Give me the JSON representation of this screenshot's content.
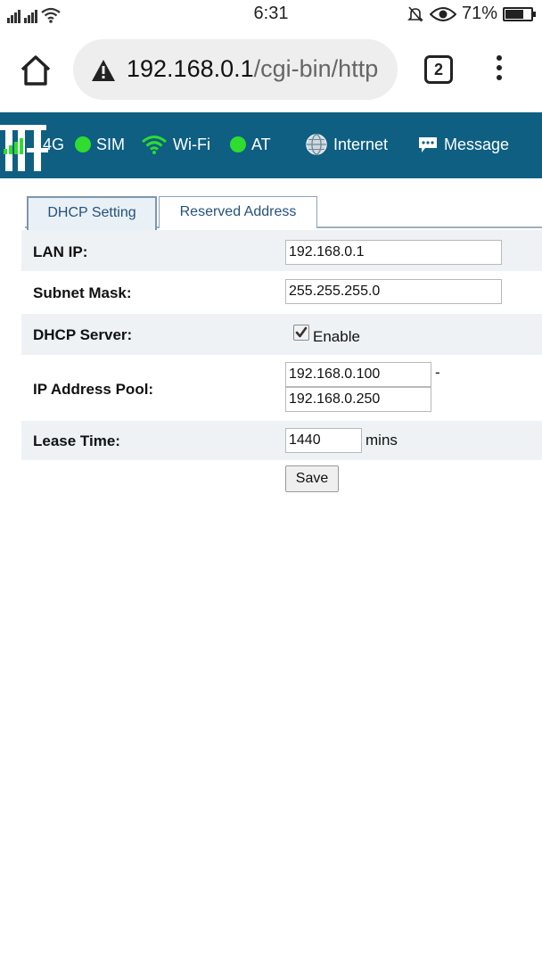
{
  "status_bar": {
    "time": "6:31",
    "battery_percent": "71%",
    "battery_level": 0.71
  },
  "browser": {
    "url_host": "192.168.0.1",
    "url_path": "/cgi-bin/http",
    "tab_count": "2"
  },
  "router_nav": {
    "items": [
      {
        "label": "4G",
        "icon": "signal-bars-icon"
      },
      {
        "label": "SIM",
        "icon": "green-dot-icon"
      },
      {
        "label": "Wi-Fi",
        "icon": "wifi-icon"
      },
      {
        "label": "AT",
        "icon": "green-dot-icon"
      },
      {
        "label": "Internet",
        "icon": "globe-icon"
      },
      {
        "label": "Message",
        "icon": "chat-bubble-icon"
      }
    ]
  },
  "tabs": [
    {
      "label": "DHCP Setting",
      "active": true
    },
    {
      "label": "Reserved Address",
      "active": false
    }
  ],
  "form": {
    "lan_ip": {
      "label": "LAN IP:",
      "value": "192.168.0.1"
    },
    "subnet_mask": {
      "label": "Subnet Mask:",
      "value": "255.255.255.0"
    },
    "dhcp_server": {
      "label": "DHCP Server:",
      "checkbox_label": "Enable",
      "checked": true
    },
    "ip_pool": {
      "label": "IP Address Pool:",
      "start": "192.168.0.100",
      "separator": "-",
      "end": "192.168.0.250"
    },
    "lease_time": {
      "label": "Lease Time:",
      "value": "1440",
      "unit": "mins"
    },
    "save_label": "Save"
  },
  "colors": {
    "nav_background": "#0e5f82",
    "status_green": "#2fdc2f",
    "row_alt": "#eef2f5",
    "tab_text": "#25527a"
  }
}
